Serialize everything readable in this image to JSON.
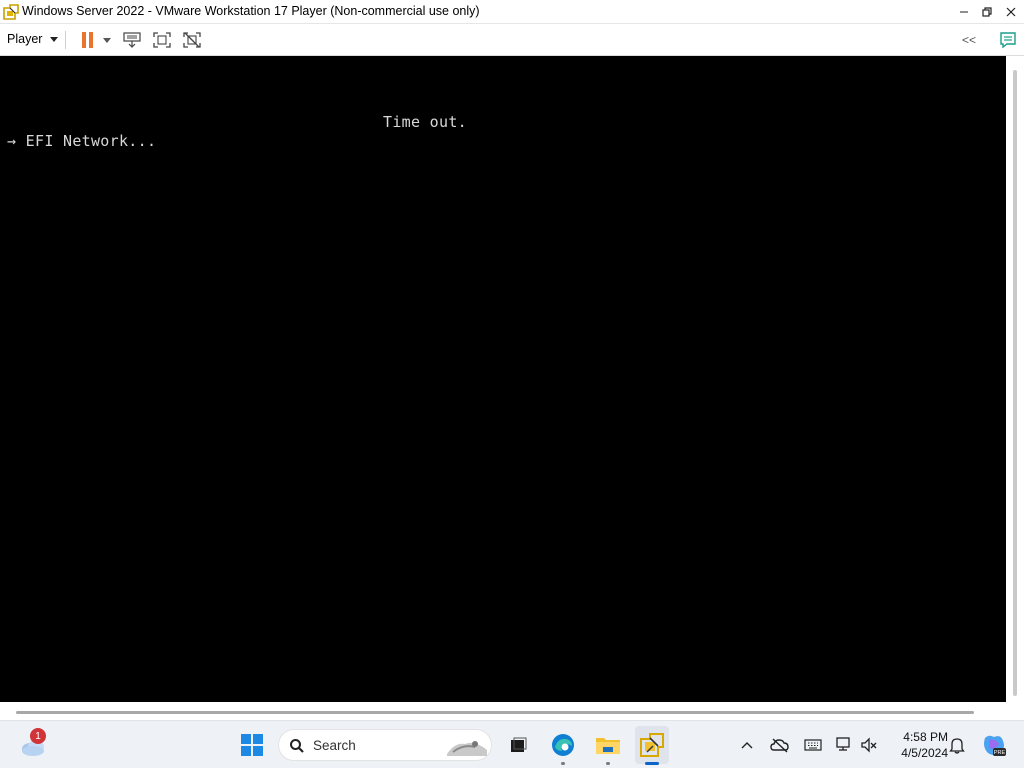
{
  "window": {
    "title": "Windows Server 2022 - VMware Workstation 17 Player (Non-commercial use only)"
  },
  "toolbar": {
    "player_label": "Player",
    "collapse_label": "<<"
  },
  "console": {
    "line1": "Time out.",
    "line2": "→ EFI Network..."
  },
  "taskbar": {
    "weather_badge": "1",
    "search_placeholder": "Search",
    "time": "4:58 PM",
    "date": "4/5/2024"
  },
  "colors": {
    "console_bg": "#000000",
    "console_fg": "#d8d8d8",
    "pause_accent": "#e8742d",
    "taskbar_bg": "#eef1f6"
  }
}
